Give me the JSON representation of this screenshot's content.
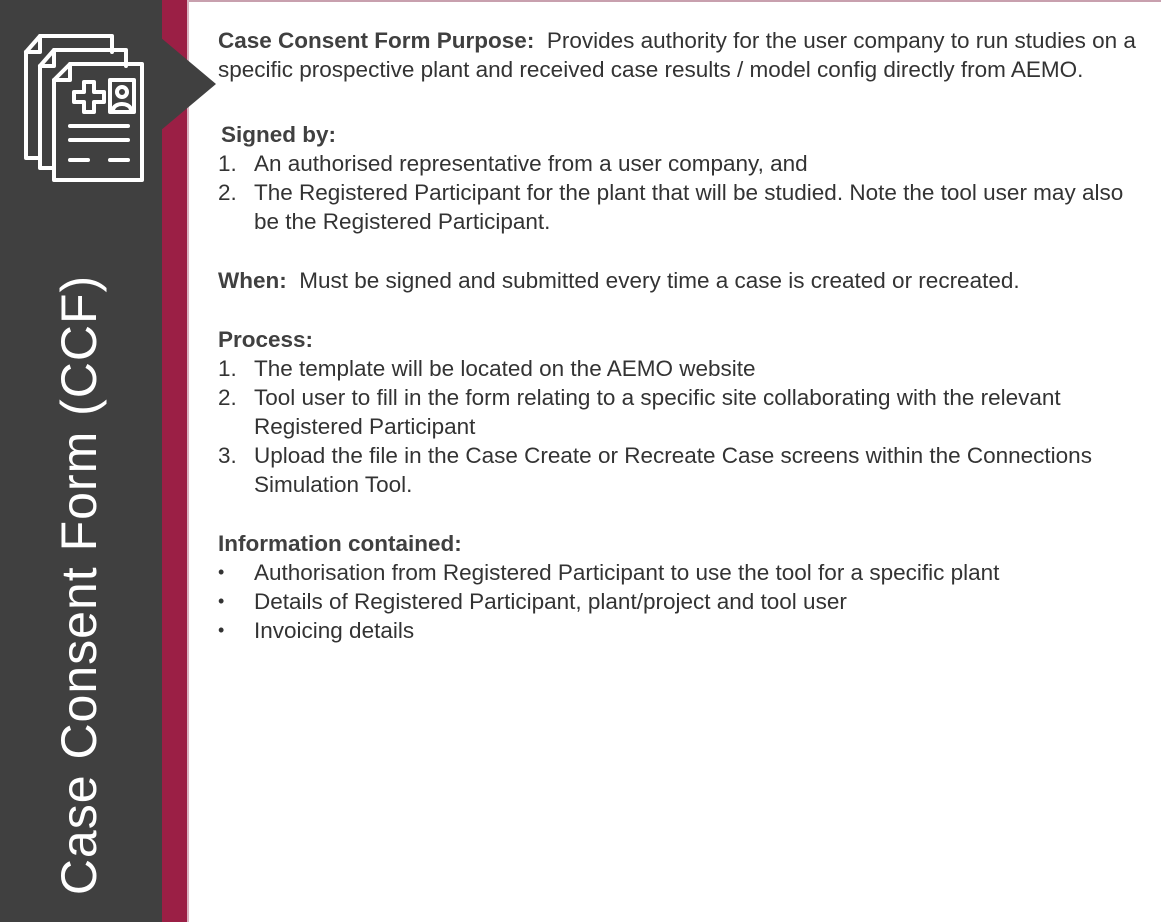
{
  "sidebar": {
    "title": "Case Consent Form (CCF)",
    "icon": "medical-forms-icon",
    "colors": {
      "panel": "#404040",
      "accent": "#9b1f45"
    }
  },
  "purpose": {
    "label": "Case Consent Form Purpose:",
    "text": "Provides authority for the user company to run studies on a specific prospective plant and received case results / model config directly from AEMO."
  },
  "signed_by": {
    "label": "Signed by:",
    "items": [
      {
        "marker": "1.",
        "text": "An authorised representative from a user company, and"
      },
      {
        "marker": "2.",
        "text": "The Registered Participant for the plant that will be studied.  Note the tool user may also be the Registered Participant."
      }
    ]
  },
  "when": {
    "label": "When:",
    "text": "Must be signed and submitted every time a case is created or recreated."
  },
  "process": {
    "label": "Process:",
    "items": [
      {
        "marker": "1.",
        "text": "The template will be located on the AEMO website"
      },
      {
        "marker": "2.",
        "text": "Tool user to fill in the form relating to a specific site collaborating with the relevant  Registered Participant"
      },
      {
        "marker": "3.",
        "text": "Upload the  file in the Case Create or Recreate Case screens within the Connections Simulation Tool."
      }
    ]
  },
  "information": {
    "label": "Information contained:",
    "items": [
      {
        "marker": "•",
        "text": "Authorisation from Registered Participant to use the tool for a specific plant"
      },
      {
        "marker": "•",
        "text": "Details of Registered Participant, plant/project and tool user"
      },
      {
        "marker": "•",
        "text": "Invoicing details"
      }
    ]
  }
}
